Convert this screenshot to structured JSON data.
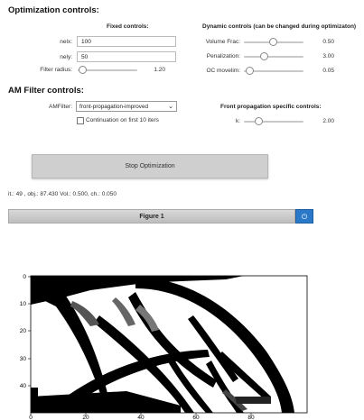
{
  "optimization": {
    "title": "Optimization controls:",
    "fixed_header": "Fixed controls:",
    "dynamic_header": "Dynamic controls (can be changed during optimizaton)",
    "nelx_label": "nelx:",
    "nelx_value": "100",
    "nely_label": "nely:",
    "nely_value": "50",
    "filter_radius_label": "Filter radius:",
    "filter_radius_value": "1.20",
    "volfrac_label": "Volume Frac:",
    "volfrac_value": "0.50",
    "penal_label": "Penalization:",
    "penal_value": "3.00",
    "oc_label": "OC movelim:",
    "oc_value": "0.05"
  },
  "am_filter": {
    "title": "AM Filter controls:",
    "filter_label": "AMFilter:",
    "filter_value": "front-propagation-improved",
    "continuation_label": "Continuation on first 10 iters",
    "continuation_checked": false,
    "front_header": "Front propagation specific controls:",
    "k_label": "k:",
    "k_value": "2.00"
  },
  "actions": {
    "stop_label": "Stop Optimization"
  },
  "status": {
    "text": "it.: 49 , obj.: 87.430 Vol.: 0.500, ch.: 0.050"
  },
  "figure": {
    "title": "Figure 1",
    "power_icon": "power-icon",
    "x_ticks": [
      "0",
      "20",
      "40",
      "60",
      "80"
    ],
    "y_ticks": [
      "0",
      "10",
      "20",
      "30",
      "40"
    ]
  }
}
